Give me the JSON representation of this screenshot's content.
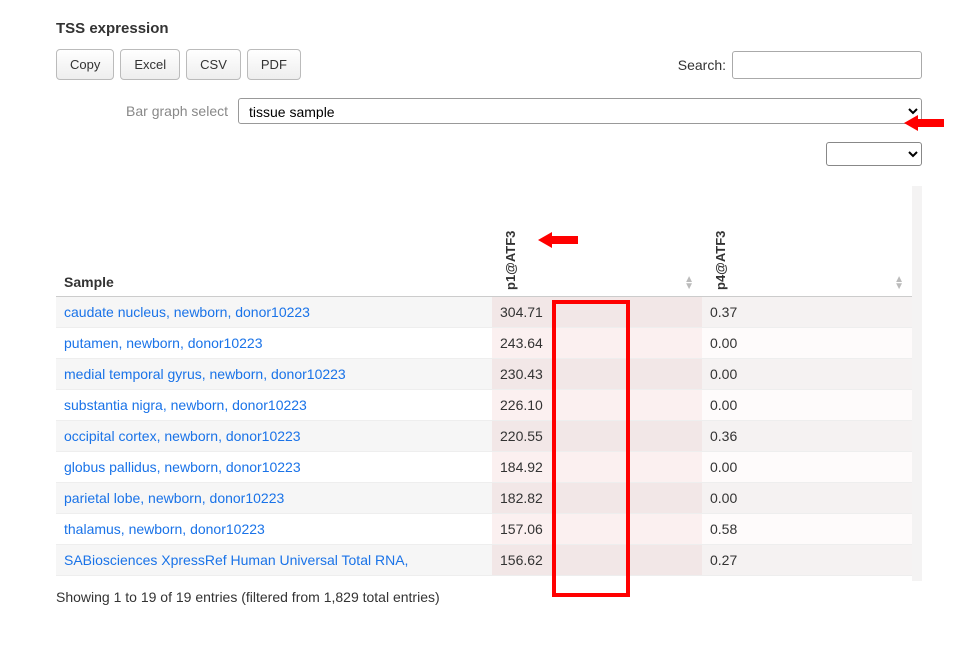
{
  "title": "TSS expression",
  "buttons": {
    "copy": "Copy",
    "excel": "Excel",
    "csv": "CSV",
    "pdf": "PDF"
  },
  "search": {
    "label": "Search:",
    "value": ""
  },
  "bargraph": {
    "label": "Bar graph select",
    "selected": "tissue sample"
  },
  "second_select": {
    "value": ""
  },
  "columns": {
    "sample": "Sample",
    "c1": "p1@ATF3",
    "c2": "p4@ATF3"
  },
  "rows": [
    {
      "sample": "caudate nucleus, newborn, donor10223",
      "v1": "304.71",
      "v2": "0.37"
    },
    {
      "sample": "putamen, newborn, donor10223",
      "v1": "243.64",
      "v2": "0.00"
    },
    {
      "sample": "medial temporal gyrus, newborn, donor10223",
      "v1": "230.43",
      "v2": "0.00"
    },
    {
      "sample": "substantia nigra, newborn, donor10223",
      "v1": "226.10",
      "v2": "0.00"
    },
    {
      "sample": "occipital cortex, newborn, donor10223",
      "v1": "220.55",
      "v2": "0.36"
    },
    {
      "sample": "globus pallidus, newborn, donor10223",
      "v1": "184.92",
      "v2": "0.00"
    },
    {
      "sample": "parietal lobe, newborn, donor10223",
      "v1": "182.82",
      "v2": "0.00"
    },
    {
      "sample": "thalamus, newborn, donor10223",
      "v1": "157.06",
      "v2": "0.58"
    },
    {
      "sample": "SABiosciences XpressRef Human Universal Total RNA,",
      "v1": "156.62",
      "v2": "0.27"
    }
  ],
  "footer": "Showing 1 to 19 of 19 entries (filtered from 1,829 total entries)"
}
